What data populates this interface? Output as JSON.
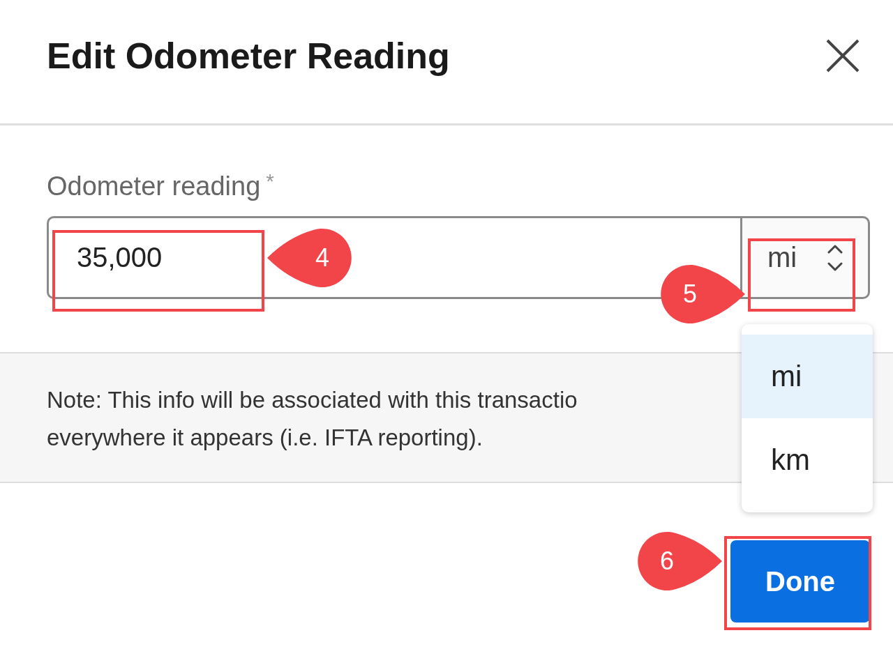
{
  "dialog": {
    "title": "Edit Odometer Reading",
    "field": {
      "label": "Odometer reading",
      "required_mark": "*",
      "value": "35,000",
      "unit": "mi"
    },
    "unit_menu": {
      "open": true,
      "options": [
        {
          "label": "mi",
          "selected": true
        },
        {
          "label": "km",
          "selected": false
        }
      ]
    },
    "note": {
      "lines": [
        "Note: This info will be associated with this transactio",
        "everywhere it appears (i.e. IFTA reporting)."
      ]
    },
    "buttons": [
      {
        "label": "Done",
        "kind": "primary"
      }
    ]
  },
  "annotations": [
    {
      "number": "4",
      "kind": "left"
    },
    {
      "number": "5",
      "kind": "right"
    },
    {
      "number": "6",
      "kind": "right"
    }
  ]
}
